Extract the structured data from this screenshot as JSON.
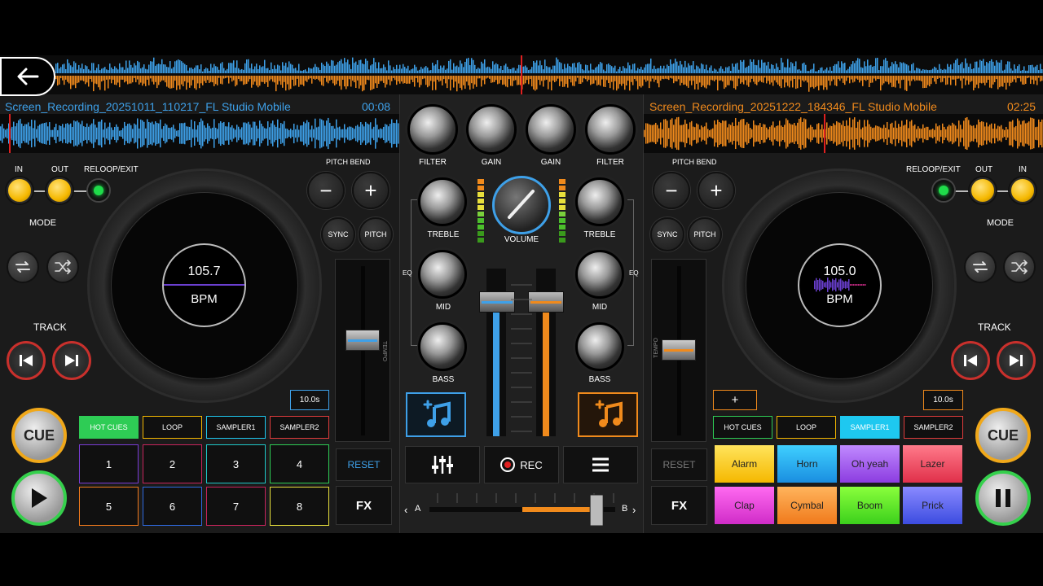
{
  "left_deck": {
    "track_title": "Screen_Recording_20251011_110217_FL Studio Mobile",
    "time": "00:08",
    "bpm": "105.7",
    "bpm_label": "BPM",
    "in_label": "IN",
    "out_label": "OUT",
    "reloop_label": "RELOOP/EXIT",
    "mode_label": "MODE",
    "track_label": "TRACK",
    "pitch_bend_label": "PITCH BEND",
    "sync_label": "SYNC",
    "pitch_label": "PITCH",
    "loop_time": "10.0s",
    "reset_label": "RESET",
    "fx_label": "FX",
    "cue_label": "CUE",
    "tabs": [
      "HOT CUES",
      "LOOP",
      "SAMPLER1",
      "SAMPLER2"
    ],
    "pads": [
      "1",
      "2",
      "3",
      "4",
      "5",
      "6",
      "7",
      "8"
    ]
  },
  "right_deck": {
    "track_title": "Screen_Recording_20251222_184346_FL Studio Mobile",
    "time": "02:25",
    "bpm": "105.0",
    "bpm_label": "BPM",
    "in_label": "IN",
    "out_label": "OUT",
    "reloop_label": "RELOOP/EXIT",
    "mode_label": "MODE",
    "track_label": "TRACK",
    "pitch_bend_label": "PITCH BEND",
    "sync_label": "SYNC",
    "pitch_label": "PITCH",
    "loop_time": "10.0s",
    "plus_label": "+",
    "reset_label": "RESET",
    "fx_label": "FX",
    "cue_label": "CUE",
    "tabs": [
      "HOT CUES",
      "LOOP",
      "SAMPLER1",
      "SAMPLER2"
    ],
    "samples": [
      "Alarm",
      "Horn",
      "Oh yeah",
      "Lazer",
      "Clap",
      "Cymbal",
      "Boom",
      "Prick"
    ]
  },
  "mixer": {
    "filter_label": "FILTER",
    "gain_label": "GAIN",
    "treble_label": "TREBLE",
    "mid_label": "MID",
    "bass_label": "BASS",
    "eq_label": "EQ",
    "volume_label": "VOLUME",
    "tempo_label": "TEMPO",
    "rec_label": "REC",
    "crossfader_a": "A",
    "crossfader_b": "B"
  },
  "state": {
    "left_volume": 0.8,
    "right_volume": 0.8,
    "crossfader": 0.93
  },
  "colors": {
    "left_accent": "#3ea0e8",
    "right_accent": "#f08a1c",
    "hot_cues_active": "#2ecc55",
    "sampler1_active": "#1ec8f0",
    "led_yellow": "#f5b800"
  }
}
